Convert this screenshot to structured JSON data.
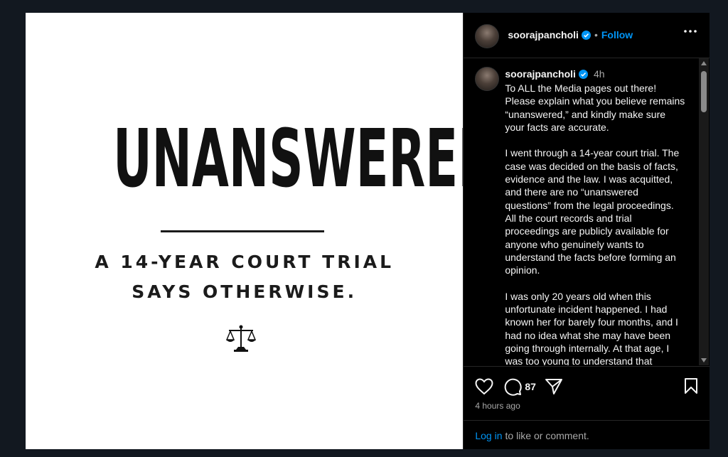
{
  "post_image": {
    "headline": "UNANSWERED?",
    "subline_1": "A 14-YEAR COURT TRIAL",
    "subline_2": "SAYS OTHERWISE.",
    "icon": "scales-of-justice-icon"
  },
  "header": {
    "username": "soorajpancholi",
    "separator": "•",
    "follow_label": "Follow",
    "verified_color": "#0095f6"
  },
  "caption": {
    "username": "soorajpancholi",
    "time_ago": "4h",
    "text": "To ALL the Media pages out there!\nPlease explain what you believe remains\n“unanswered,” and kindly make sure\nyour facts are accurate.\n\nI went through a 14-year court trial. The\ncase was decided on the basis of facts,\nevidence and the law. I was acquitted,\nand there are no “unanswered\nquestions” from the legal proceedings.\nAll the court records and trial\nproceedings are publicly available for\nanyone who genuinely wants to\nunderstand the facts before forming an\nopinion.\n\nI was only 20 years old when this\nunfortunate incident happened. I had\nknown her for barely four months, and I\nhad no idea what she may have been\ngoing through internally. At that age, I\nwas too young to understand that"
  },
  "actions": {
    "comment_count": "87",
    "posted_time": "4 hours ago"
  },
  "login": {
    "link": "Log in",
    "rest": "to like or comment."
  },
  "colors": {
    "accent": "#0095f6",
    "background": "#000000",
    "muted": "#a8a8a8"
  }
}
